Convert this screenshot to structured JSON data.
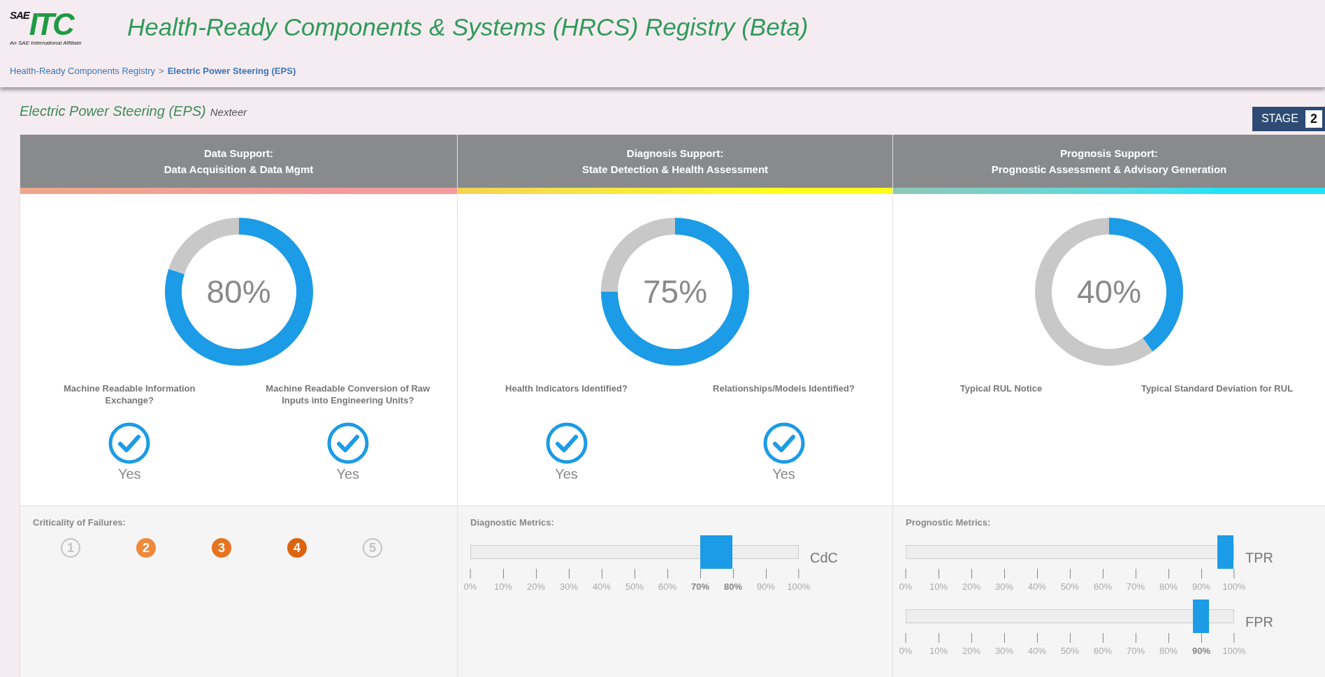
{
  "logo": {
    "prefix": "SAE",
    "name": "ITC",
    "tagline": "An SAE International Affiliate"
  },
  "title": "Health-Ready Components & Systems (HRCS) Registry (Beta)",
  "breadcrumb": [
    {
      "label": "Health-Ready Components Registry",
      "current": false
    },
    {
      "label": "Electric Power Steering (EPS)",
      "current": true
    }
  ],
  "breadcrumb_separator": ">",
  "component": {
    "name": "Electric Power Steering (EPS)",
    "maker": "Nexteer"
  },
  "stage": {
    "label": "STAGE",
    "value": "2"
  },
  "columns": [
    {
      "heading": "Data Support:",
      "subheading": "Data Acquisition & Data Mgmt",
      "color": "#f59c9c",
      "donut": {
        "reading": "80%",
        "chart_data": {
          "type": "donut",
          "values": [
            80,
            20
          ]
        }
      },
      "questions": [
        {
          "text": "Machine Readable Information Exchange?",
          "answer": "Yes",
          "checked": true
        },
        {
          "text": "Machine Readable Conversion of Raw Inputs into Engineering Units?",
          "answer": "Yes",
          "checked": true
        }
      ],
      "footer": {
        "kind": "criticality",
        "label": "Criticality of Failures:",
        "levels": [
          {
            "label": "1",
            "selected": false,
            "color": "#c4c4c4"
          },
          {
            "label": "2",
            "selected": true,
            "color": "#ef8a3c"
          },
          {
            "label": "3",
            "selected": true,
            "color": "#e8731f"
          },
          {
            "label": "4",
            "selected": true,
            "color": "#dc6410"
          },
          {
            "label": "5",
            "selected": false,
            "color": "#c4c4c4"
          }
        ]
      }
    },
    {
      "heading": "Diagnosis Support:",
      "subheading": "State Detection & Health Assessment",
      "color": "#ffff1a",
      "donut": {
        "reading": "75%",
        "chart_data": {
          "type": "donut",
          "values": [
            75,
            25
          ]
        }
      },
      "questions": [
        {
          "text": "Health Indicators Identified?",
          "answer": "Yes",
          "checked": true
        },
        {
          "text": "Relationships/Models Identified?",
          "answer": "Yes",
          "checked": true
        }
      ],
      "footer": {
        "kind": "metrics",
        "label": "Diagnostic Metrics:",
        "metrics": [
          {
            "name": "CdC",
            "level": 0.75,
            "ticks": [
              {
                "label": "0%",
                "bold": false
              },
              {
                "label": "10%",
                "bold": false
              },
              {
                "label": "20%",
                "bold": false
              },
              {
                "label": "30%",
                "bold": false
              },
              {
                "label": "40%",
                "bold": false
              },
              {
                "label": "50%",
                "bold": false
              },
              {
                "label": "60%",
                "bold": false
              },
              {
                "label": "70%",
                "bold": true
              },
              {
                "label": "80%",
                "bold": true
              },
              {
                "label": "90%",
                "bold": false
              },
              {
                "label": "100%",
                "bold": false
              }
            ]
          }
        ]
      }
    },
    {
      "heading": "Prognosis Support:",
      "subheading": "Prognostic Assessment & Advisory Generation",
      "color": "#22e3f5",
      "donut": {
        "reading": "40%",
        "chart_data": {
          "type": "donut",
          "values": [
            40,
            60
          ]
        }
      },
      "questions": [
        {
          "text": "Typical RUL Notice"
        },
        {
          "text": "Typical Standard Deviation for RUL"
        }
      ],
      "footer": {
        "kind": "metrics",
        "label": "Prognostic Metrics:",
        "metrics": [
          {
            "name": "TPR",
            "level": 0.975,
            "ticks": [
              {
                "label": "0%",
                "bold": false
              },
              {
                "label": "10%",
                "bold": false
              },
              {
                "label": "20%",
                "bold": false
              },
              {
                "label": "30%",
                "bold": false
              },
              {
                "label": "40%",
                "bold": false
              },
              {
                "label": "50%",
                "bold": false
              },
              {
                "label": "60%",
                "bold": false
              },
              {
                "label": "70%",
                "bold": false
              },
              {
                "label": "80%",
                "bold": false
              },
              {
                "label": "90%",
                "bold": false
              },
              {
                "label": "100%",
                "bold": false
              }
            ]
          },
          {
            "name": "FPR",
            "level": 0.9,
            "ticks": [
              {
                "label": "0%",
                "bold": false
              },
              {
                "label": "10%",
                "bold": false
              },
              {
                "label": "20%",
                "bold": false
              },
              {
                "label": "30%",
                "bold": false
              },
              {
                "label": "40%",
                "bold": false
              },
              {
                "label": "50%",
                "bold": false
              },
              {
                "label": "60%",
                "bold": false
              },
              {
                "label": "70%",
                "bold": false
              },
              {
                "label": "80%",
                "bold": false
              },
              {
                "label": "90%",
                "bold": true
              },
              {
                "label": "100%",
                "bold": false
              }
            ]
          }
        ]
      }
    }
  ]
}
